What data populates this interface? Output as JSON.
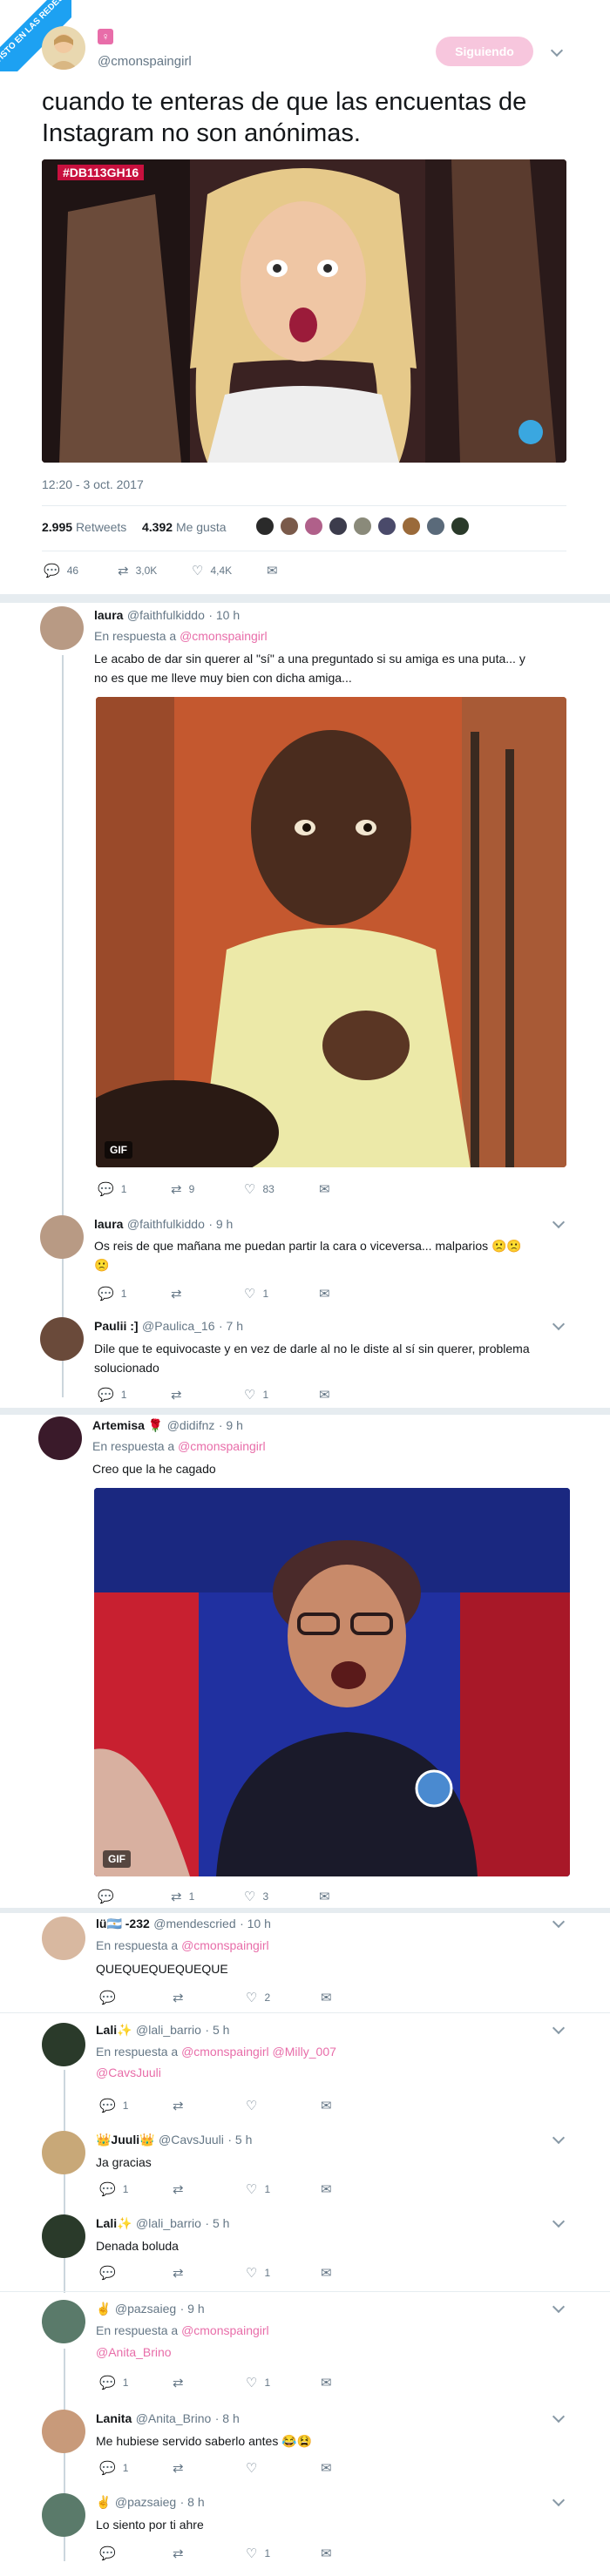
{
  "badge": {
    "text": "VISTO EN LAS REDES"
  },
  "main": {
    "handle": "@cmonspaingirl",
    "follow_label": "Siguiendo",
    "text_line1": "cuando te enteras de que las encuentas de",
    "text_line2": "Instagram no son anónimas.",
    "image_tag": "#DB113GH16",
    "timestamp": "12:20 - 3 oct. 2017",
    "retweets_count": "2.995",
    "retweets_label": "Retweets",
    "likes_count": "4.392",
    "likes_label": "Me gusta",
    "replies": "46",
    "rts": "3,0K",
    "favs": "4,4K"
  },
  "replies": [
    {
      "name": "laura",
      "handle": "@faithfulkiddo",
      "time": "· 10 h",
      "in_reply": "En respuesta a",
      "to": "@cmonspaingirl",
      "text1": "Le acabo de dar sin querer al \"sí\" a una preguntado si su amiga es una puta... y",
      "text2": "no es que me lleve muy bien con dicha amiga...",
      "gif": "GIF",
      "r": "1",
      "rt": "9",
      "fav": "83"
    },
    {
      "name": "laura",
      "handle": "@faithfulkiddo",
      "time": "· 9 h",
      "text1": "Os reis de que mañana me puedan partir la cara o viceversa... malparios 🙁🙁",
      "text2": "🙁",
      "r": "1",
      "rt": "",
      "fav": "1"
    },
    {
      "name": "Paulii :]",
      "handle": "@Paulica_16",
      "time": "· 7 h",
      "text1": "Dile que te equivocaste y en vez de darle al no le diste al sí sin querer, problema",
      "text2": "solucionado",
      "r": "1",
      "rt": "",
      "fav": "1"
    },
    {
      "name": "Artemisa 🌹",
      "handle": "@didifnz",
      "time": "· 9 h",
      "in_reply": "En respuesta a",
      "to": "@cmonspaingirl",
      "text1": "Creo que la he cagado",
      "gif": "GIF",
      "r": "",
      "rt": "1",
      "fav": "3"
    },
    {
      "name": "lü🇦🇷 -232",
      "handle": "@mendescried",
      "time": "· 10 h",
      "in_reply": "En respuesta a",
      "to": "@cmonspaingirl",
      "text1": "QUEQUEQUEQUEQUE",
      "r": "",
      "rt": "",
      "fav": "2"
    },
    {
      "name": "Lali✨",
      "handle": "@lali_barrio",
      "time": "· 5 h",
      "in_reply": "En respuesta a",
      "to": "@cmonspaingirl @Milly_007",
      "to2": "@CavsJuuli",
      "r": "1",
      "rt": "",
      "fav": ""
    },
    {
      "name": "👑Juuli👑",
      "handle": "@CavsJuuli",
      "time": "· 5 h",
      "text1": "Ja gracias",
      "r": "1",
      "rt": "",
      "fav": "1"
    },
    {
      "name": "Lali✨",
      "handle": "@lali_barrio",
      "time": "· 5 h",
      "text1": "Denada boluda",
      "r": "",
      "rt": "",
      "fav": "1"
    },
    {
      "name": "✌",
      "handle": "@pazsaieg",
      "time": "· 9 h",
      "in_reply": "En respuesta a",
      "to": "@cmonspaingirl",
      "to2": "@Anita_Brino",
      "r": "1",
      "rt": "",
      "fav": "1"
    },
    {
      "name": "Lanita",
      "handle": "@Anita_Brino",
      "time": "· 8 h",
      "text1": "Me hubiese servido saberlo antes 😂😫",
      "r": "1",
      "rt": "",
      "fav": ""
    },
    {
      "name": "✌",
      "handle": "@pazsaieg",
      "time": "· 8 h",
      "text1": "Lo siento por ti ahre",
      "r": "",
      "rt": "",
      "fav": "1"
    }
  ],
  "icons": {
    "reply": "reply-icon",
    "retweet": "retweet-icon",
    "like": "heart-icon",
    "dm": "envelope-icon",
    "chevron": "chevron-down-icon"
  },
  "colors": {
    "accent": "#e86da9",
    "follow_bg": "#f7c6dd",
    "text": "#14171a",
    "muted": "#657786"
  }
}
